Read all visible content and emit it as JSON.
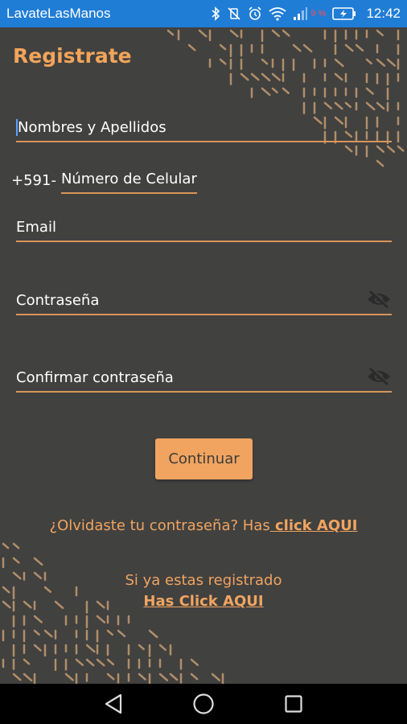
{
  "status_bar": {
    "app_name": "LavateLasManos",
    "battery_percent": "9 %",
    "time": "12:42",
    "icons": [
      "bluetooth-icon",
      "vibrate-off-icon",
      "alarm-icon",
      "wifi-icon",
      "signal-icon",
      "battery-charging-icon"
    ]
  },
  "screen": {
    "title": "Registrate"
  },
  "form": {
    "name_label": "Nombres y Apellidos",
    "phone_prefix": "+591-",
    "phone_label": "Número de Celular",
    "email_label": "Email",
    "password_label": "Contraseña",
    "confirm_label": "Confirmar contraseña",
    "continue_label": "Continuar"
  },
  "links": {
    "forgot_text": "¿Olvidaste tu contraseña? Has",
    "forgot_link": " click AQUI",
    "registered_text": "Si ya estas registrado",
    "registered_link": "Has Click AQUI"
  },
  "colors": {
    "background": "#414140",
    "accent": "#f1a45f",
    "status_bar": "#1f7dd6"
  }
}
